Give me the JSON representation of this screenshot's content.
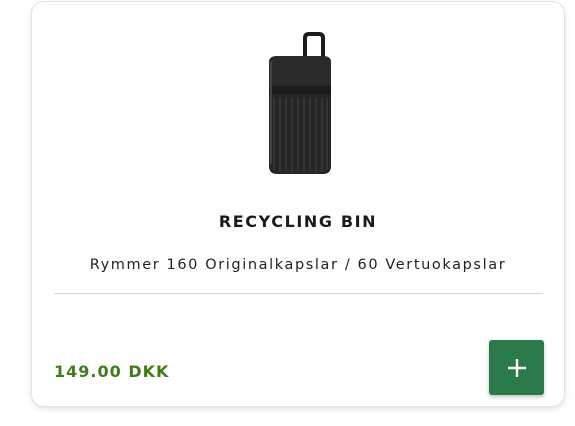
{
  "product": {
    "title": "RECYCLING BIN",
    "subtitle": "Rymmer 160 Originalkapslar / 60 Vertuokapslar",
    "price": "149.00 DKK",
    "image_icon": "recycling-bin-image"
  },
  "add_button": {
    "icon": "plus-icon"
  },
  "colors": {
    "price": "#3e7d17",
    "add_button_bg": "#2b7a4b",
    "title": "#1a1a1a"
  }
}
